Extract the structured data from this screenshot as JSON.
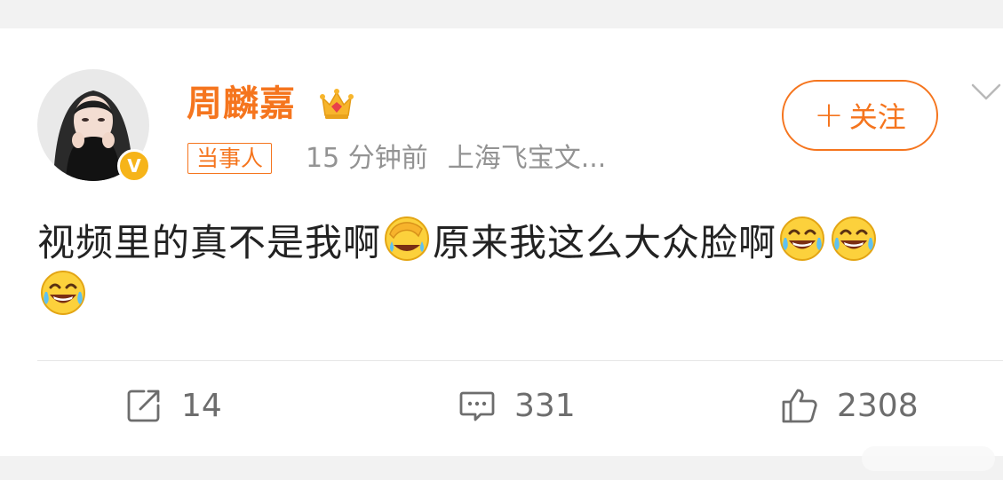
{
  "post": {
    "author": {
      "name": "周麟嘉",
      "badge_icon": "crown-icon",
      "verified_icon": "v-verified-icon",
      "verified_mark": "V"
    },
    "tag": "当事人",
    "time": "15 分钟前",
    "source": "上海飞宝文...",
    "follow_label": "关注",
    "text_segments": [
      "视频里的真不是我啊",
      "原来我这么大众脸啊"
    ],
    "emojis": [
      "facepalm-laugh-emoji",
      "tears-of-joy-emoji",
      "tears-of-joy-emoji",
      "tears-of-joy-emoji"
    ]
  },
  "actions": {
    "repost_count": "14",
    "comment_count": "331",
    "like_count": "2308"
  },
  "colors": {
    "accent": "#f5751e",
    "meta_gray": "#939393",
    "verified_gold": "#f6b419"
  }
}
